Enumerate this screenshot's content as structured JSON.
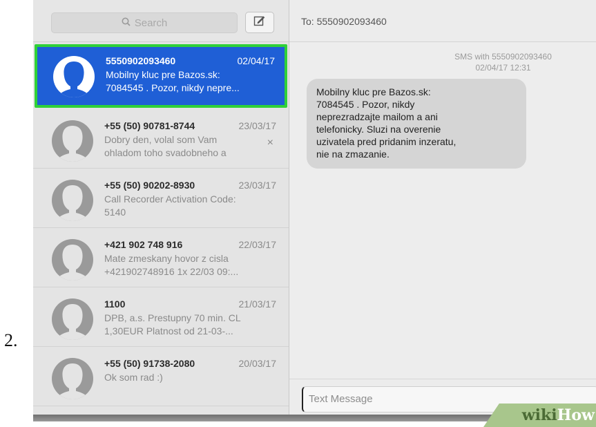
{
  "step_label": "2.",
  "search": {
    "placeholder": "Search"
  },
  "conversations": [
    {
      "sender": "5550902093460",
      "date": "02/04/17",
      "preview_line1": "Mobilny kluc pre Bazos.sk:",
      "preview_line2": "7084545 . Pozor, nikdy nepre...",
      "selected": true
    },
    {
      "sender": "+55 (50) 90781-8744",
      "date": "23/03/17",
      "preview_line1": "Dobry den, volal som Vam",
      "preview_line2": "ohladom toho svadobneho a",
      "delete_icon": "×"
    },
    {
      "sender": "+55 (50) 90202-8930",
      "date": "23/03/17",
      "preview_line1": "Call Recorder Activation Code:",
      "preview_line2": "5140"
    },
    {
      "sender": "+421 902 748 916",
      "date": "22/03/17",
      "preview_line1": "Mate zmeskany hovor z cisla",
      "preview_line2": "+421902748916 1x 22/03 09:..."
    },
    {
      "sender": "1100",
      "date": "21/03/17",
      "preview_line1": "DPB, a.s. Prestupny 70 min. CL",
      "preview_line2": "1,30EUR Platnost od 21-03-..."
    },
    {
      "sender": "+55 (50) 91738-2080",
      "date": "20/03/17",
      "preview_line1": "Ok som rad :)",
      "preview_line2": ""
    }
  ],
  "conversation": {
    "to_label": "To:",
    "to_number": "5550902093460",
    "header_line1": "SMS with 5550902093460",
    "header_line2": "02/04/17 12:31",
    "message_lines": [
      "Mobilny kluc pre Bazos.sk:",
      "7084545 . Pozor, nikdy",
      "neprezradzajte mailom a ani",
      "telefonicky. Sluzi na overenie",
      "uzivatela pred pridanim inzeratu,",
      "nie na zmazanie."
    ],
    "input_placeholder": "Text Message"
  },
  "watermark": {
    "part1": "wiki",
    "part2": "How"
  },
  "colors": {
    "selection": "#1f5fd6",
    "highlight_border": "#2fd138",
    "bubble": "#d5d5d5"
  }
}
